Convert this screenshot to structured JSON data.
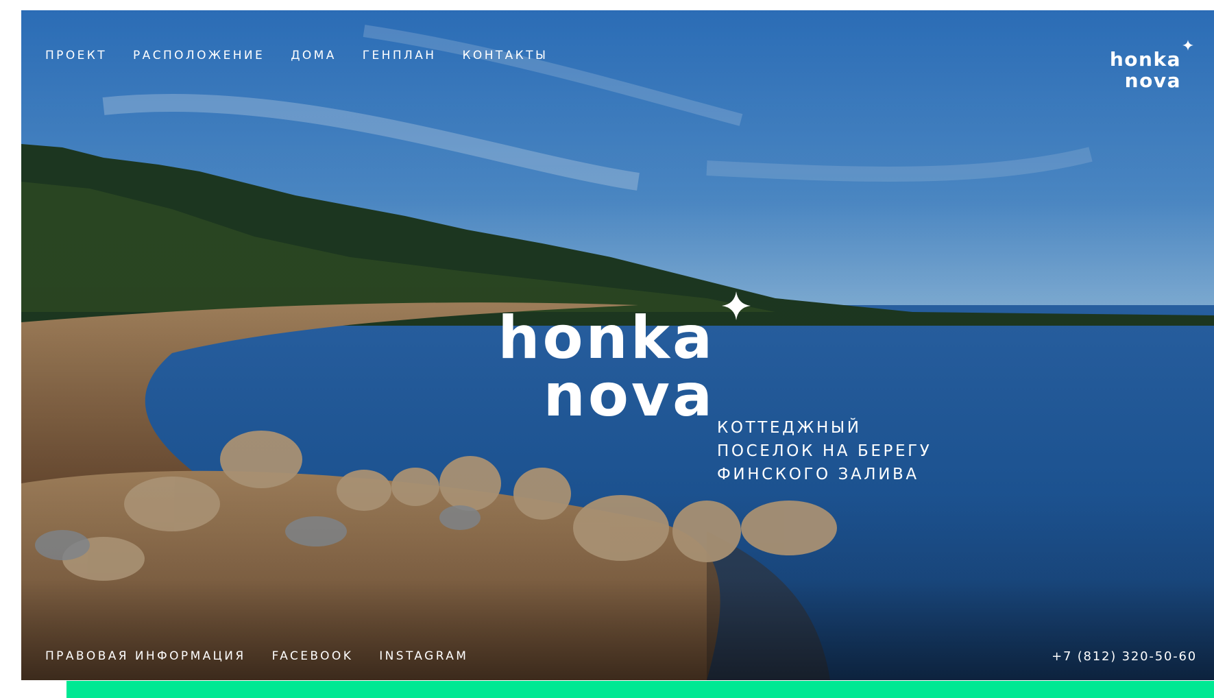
{
  "nav": {
    "items": [
      {
        "label": "ПРОЕКТ"
      },
      {
        "label": "РАСПОЛОЖЕНИЕ"
      },
      {
        "label": "ДОМА"
      },
      {
        "label": "ГЕНПЛАН"
      },
      {
        "label": "КОНТАКТЫ"
      }
    ]
  },
  "logo": {
    "line1": "honka",
    "line2": "nova"
  },
  "hero": {
    "tagline": [
      "КОТТЕДЖНЫЙ",
      "ПОСЕЛОК НА БЕРЕГУ",
      "ФИНСКОГО ЗАЛИВА"
    ]
  },
  "footer": {
    "links": [
      {
        "label": "ПРАВОВАЯ ИНФОРМАЦИЯ"
      },
      {
        "label": "FACEBOOK"
      },
      {
        "label": "INSTAGRAM"
      }
    ],
    "phone": "+7 (812) 320-50-60"
  },
  "colors": {
    "accent": "#00e893",
    "text": "#ffffff",
    "sky": "#2d72bf",
    "sea": "#1f5a9e"
  },
  "icons": [
    "sparkle-icon"
  ]
}
